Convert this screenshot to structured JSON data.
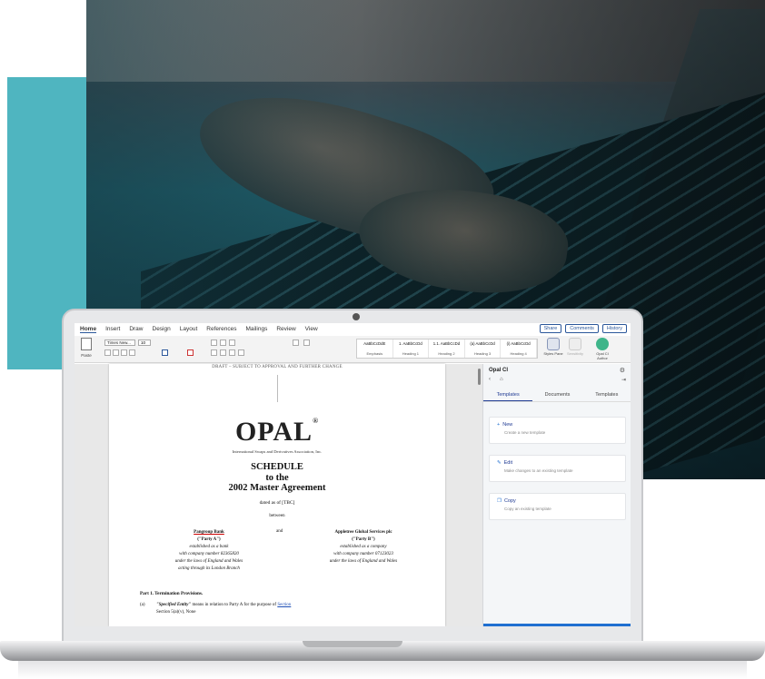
{
  "word": {
    "menu_tabs": [
      "Home",
      "Insert",
      "Draw",
      "Design",
      "Layout",
      "References",
      "Mailings",
      "Review",
      "View"
    ],
    "share_label": "Share",
    "comments_label": "Comments",
    "history_label": "History",
    "paste_label": "Paste",
    "font_name": "Times New...",
    "font_size": "10",
    "styles": [
      {
        "sample": "AaBbCcDdE",
        "name": "Emphasis"
      },
      {
        "sample": "1. AaBbCcDd",
        "name": "Heading 1"
      },
      {
        "sample": "1.1. AaBbCcDd",
        "name": "Heading 2"
      },
      {
        "sample": "(a) AaBbCcDd",
        "name": "Heading 3"
      },
      {
        "sample": "(i) AaBbCcDd",
        "name": "Heading 4"
      }
    ],
    "styles_pane_label": "Styles Pane",
    "sensitivity_label": "Sensitivity",
    "opal_author_label": "Opal CI Author"
  },
  "document": {
    "draft_notice": "DRAFT – SUBJECT TO APPROVAL AND FURTHER CHANGE",
    "logo": "OPAL",
    "logo_mark": "®",
    "isda_line": "International Swaps and Derivatives Association, Inc.",
    "schedule_lines": [
      "SCHEDULE",
      "to the",
      "2002 Master Agreement"
    ],
    "dated": "dated as of [TBC]",
    "between": "between",
    "and": "and",
    "party_a": {
      "name": "Pangroup Bank",
      "tag": "(\"Party A\")",
      "lines": [
        "established as a bank",
        "with company number 82365820",
        "under the laws of England and Wales",
        "acting through its London Branch"
      ]
    },
    "party_b": {
      "name": "Appletree Global Services plc",
      "tag": "(\"Party B\")",
      "lines": [
        "established as a company",
        "with company number 07123023",
        "under the laws of England and Wales"
      ]
    },
    "part1": "Part 1.   Termination Provisions.",
    "para_num": "(a)",
    "para_term": "\"Specified Entity\"",
    "para_text": " means in relation to Party A for the purpose of ",
    "para_link": "Section",
    "para_tail": "Section 5(a)(v), None"
  },
  "panel": {
    "title": "Opal CI",
    "tabs": [
      "Templates",
      "Documents",
      "Templates"
    ],
    "cards": [
      {
        "icon": "+",
        "title": "New",
        "subtitle": "Create a new template"
      },
      {
        "icon": "✎",
        "title": "Edit",
        "subtitle": "Make changes to an existing template"
      },
      {
        "icon": "❐",
        "title": "Copy",
        "subtitle": "Copy an existing template"
      }
    ]
  }
}
